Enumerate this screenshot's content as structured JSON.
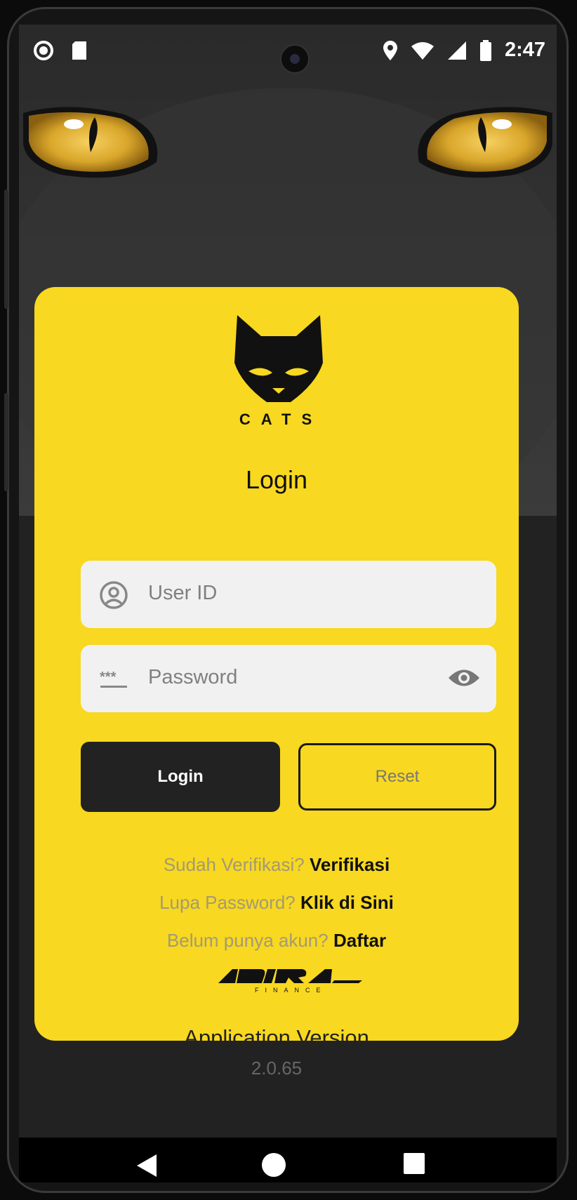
{
  "status_bar": {
    "time": "2:47",
    "left_icons": [
      "record-icon",
      "sd-card-icon"
    ],
    "right_icons": [
      "location-icon",
      "wifi-icon",
      "signal-icon",
      "battery-icon"
    ]
  },
  "card": {
    "brand": "CATS",
    "title": "Login",
    "user_id": {
      "placeholder": "User ID",
      "value": ""
    },
    "password": {
      "placeholder": "Password",
      "value": ""
    },
    "login_label": "Login",
    "reset_label": "Reset",
    "links": [
      {
        "prefix": "Sudah Verifikasi?",
        "action": "Verifikasi"
      },
      {
        "prefix": "Lupa Password?",
        "action": "Klik di Sini"
      },
      {
        "prefix": "Belum punya akun?",
        "action": "Daftar"
      }
    ],
    "partner_logo_text": "ADIRA FINANCE",
    "version_label": "Application Version",
    "version_number": "2.0.65"
  },
  "colors": {
    "card_bg": "#f8d820",
    "button_dark": "#222222",
    "field_bg": "#f1f1f1",
    "eye_iris": "#e0b030"
  }
}
